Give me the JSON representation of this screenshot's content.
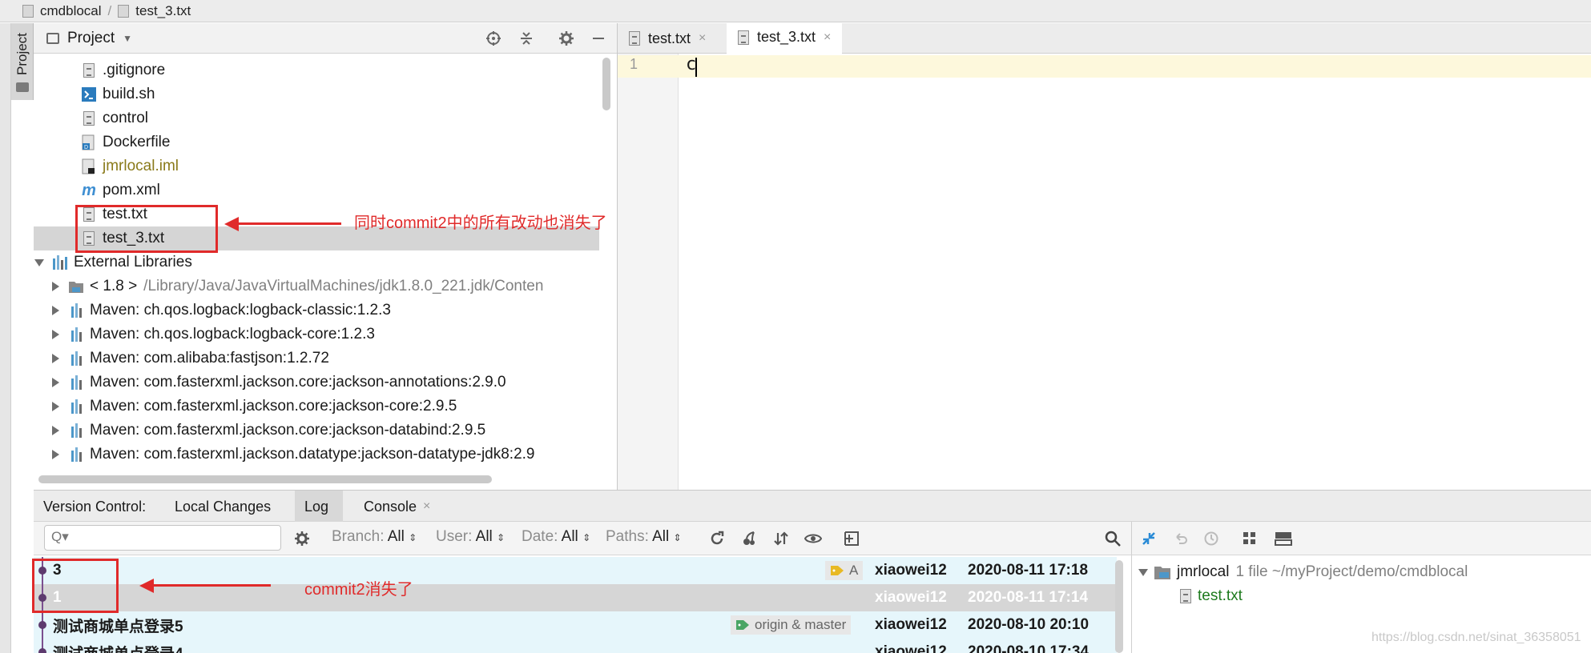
{
  "breadcrumb": {
    "project": "cmdblocal",
    "file": "test_3.txt"
  },
  "tool_window": {
    "vertical_label": "Project"
  },
  "project_panel": {
    "title": "Project",
    "tree": [
      {
        "label": ".gitignore",
        "kind": "file"
      },
      {
        "label": "build.sh",
        "kind": "shell"
      },
      {
        "label": "control",
        "kind": "file"
      },
      {
        "label": "Dockerfile",
        "kind": "docker"
      },
      {
        "label": "jmrlocal.iml",
        "kind": "iml"
      },
      {
        "label": "pom.xml",
        "kind": "maven"
      },
      {
        "label": "test.txt",
        "kind": "file"
      },
      {
        "label": "test_3.txt",
        "kind": "file"
      },
      {
        "label": "External Libraries",
        "kind": "libs"
      },
      {
        "label": "< 1.8 >",
        "extra": "/Library/Java/JavaVirtualMachines/jdk1.8.0_221.jdk/Conten",
        "kind": "jdk"
      },
      {
        "label": "Maven: ch.qos.logback:logback-classic:1.2.3",
        "kind": "lib"
      },
      {
        "label": "Maven: ch.qos.logback:logback-core:1.2.3",
        "kind": "lib"
      },
      {
        "label": "Maven: com.alibaba:fastjson:1.2.72",
        "kind": "lib"
      },
      {
        "label": "Maven: com.fasterxml.jackson.core:jackson-annotations:2.9.0",
        "kind": "lib"
      },
      {
        "label": "Maven: com.fasterxml.jackson.core:jackson-core:2.9.5",
        "kind": "lib"
      },
      {
        "label": "Maven: com.fasterxml.jackson.core:jackson-databind:2.9.5",
        "kind": "lib"
      },
      {
        "label": "Maven: com.fasterxml.jackson.datatype:jackson-datatype-jdk8:2.9",
        "kind": "lib"
      }
    ]
  },
  "annotations": {
    "files_note": "同时commit2中的所有改动也消失了",
    "log_note": "commit2消失了"
  },
  "editor": {
    "tabs": [
      {
        "label": "test.txt",
        "close": "×"
      },
      {
        "label": "test_3.txt",
        "close": "×"
      }
    ],
    "line_number": "1",
    "content": "c"
  },
  "bottom_panel": {
    "tabs": [
      "Version Control:",
      "Local Changes",
      "Log",
      "Console"
    ],
    "console_close": "×",
    "search_placeholder": "Q▾",
    "filters": [
      {
        "label": "Branch:",
        "value": "All"
      },
      {
        "label": "User:",
        "value": "All"
      },
      {
        "label": "Date:",
        "value": "All"
      },
      {
        "label": "Paths:",
        "value": "All"
      }
    ],
    "commits": [
      {
        "message": "3",
        "tag": "A",
        "author": "xiaowei12",
        "date": "2020-08-11 17:18"
      },
      {
        "message": "1",
        "tag": "",
        "author": "xiaowei12",
        "date": "2020-08-11 17:14"
      },
      {
        "message": "测试商城单点登录5",
        "tag": "origin & master",
        "author": "xiaowei12",
        "date": "2020-08-10 20:10"
      },
      {
        "message": "测试商城单点登录4",
        "tag": "",
        "author": "xiaowei12",
        "date": "2020-08-10 17:34"
      }
    ],
    "changes": {
      "root_label": "jmrlocal",
      "root_meta": "1 file  ~/myProject/demo/cmdblocal",
      "file": "test.txt"
    }
  },
  "watermark": "https://blog.csdn.net/sinat_36358051",
  "colors": {
    "annotation": "#e02a2a",
    "commit_bg": "#e6f6fb",
    "selected_commit_bg": "#d6d6d6",
    "graph": "#7b4f8f",
    "changed_file": "#1d7a1d"
  }
}
